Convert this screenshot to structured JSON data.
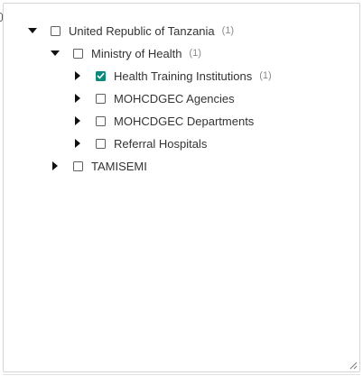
{
  "tree": {
    "nodes": [
      {
        "id": "united-republic-of-tanzania",
        "label": "United Republic of Tanzania",
        "count": "(1)",
        "expanded": true,
        "checked": false
      },
      {
        "id": "ministry-of-health",
        "label": "Ministry of Health",
        "count": "(1)",
        "expanded": true,
        "checked": false
      },
      {
        "id": "health-training-institutions",
        "label": "Health Training Institutions",
        "count": "(1)",
        "expanded": false,
        "checked": true
      },
      {
        "id": "mohcdgec-agencies",
        "label": "MOHCDGEC Agencies",
        "expanded": false,
        "checked": false
      },
      {
        "id": "mohcdgec-departments",
        "label": "MOHCDGEC Departments",
        "expanded": false,
        "checked": false
      },
      {
        "id": "referral-hospitals",
        "label": "Referral Hospitals",
        "expanded": false,
        "checked": false
      },
      {
        "id": "tamisemi",
        "label": "TAMISEMI",
        "expanded": false,
        "checked": false
      }
    ]
  },
  "colors": {
    "checked": "#0a8a7a",
    "text": "#333333",
    "count": "#8a8a8a"
  },
  "icons": {
    "expanded": "caret-down-icon",
    "collapsed": "caret-right-icon",
    "checked": "check-icon",
    "resize": "resize-grip-icon"
  }
}
